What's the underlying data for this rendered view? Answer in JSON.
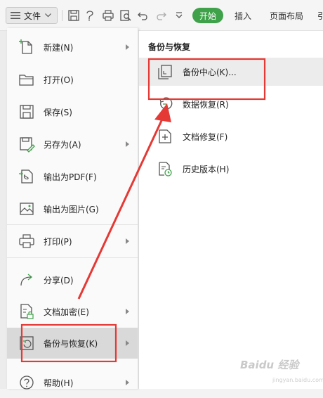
{
  "toolbar": {
    "file_label": "文件",
    "tabs": {
      "start": "开始",
      "insert": "插入",
      "page_layout": "页面布局",
      "clipped": "引"
    },
    "accent": "#3fa14a"
  },
  "menu": {
    "items": [
      {
        "label": "新建(N)",
        "icon": "new-doc-icon",
        "has_arrow": true
      },
      {
        "label": "打开(O)",
        "icon": "folder-icon",
        "has_arrow": false
      },
      {
        "label": "保存(S)",
        "icon": "save-icon",
        "has_arrow": false
      },
      {
        "label": "另存为(A)",
        "icon": "save-as-icon",
        "has_arrow": true
      },
      {
        "label": "输出为PDF(F)",
        "icon": "pdf-icon",
        "has_arrow": false
      },
      {
        "label": "输出为图片(G)",
        "icon": "image-icon",
        "has_arrow": false
      },
      {
        "label": "打印(P)",
        "icon": "printer-icon",
        "has_arrow": true
      },
      {
        "label": "分享(D)",
        "icon": "share-icon",
        "has_arrow": false
      },
      {
        "label": "文档加密(E)",
        "icon": "encrypt-icon",
        "has_arrow": true
      },
      {
        "label": "备份与恢复(K)",
        "icon": "backup-icon",
        "has_arrow": true,
        "active": true
      },
      {
        "label": "帮助(H)",
        "icon": "help-icon",
        "has_arrow": true
      }
    ]
  },
  "submenu": {
    "title": "备份与恢复",
    "items": [
      {
        "label": "备份中心(K)...",
        "icon": "backup-center-icon"
      },
      {
        "label": "数据恢复(R)",
        "icon": "data-recovery-icon"
      },
      {
        "label": "文档修复(F)",
        "icon": "doc-repair-icon"
      },
      {
        "label": "历史版本(H)",
        "icon": "history-icon"
      }
    ]
  },
  "annotation_color": "#e53935",
  "watermark": {
    "text": "Baidu 经验",
    "url": "jingyan.baidu.com"
  }
}
